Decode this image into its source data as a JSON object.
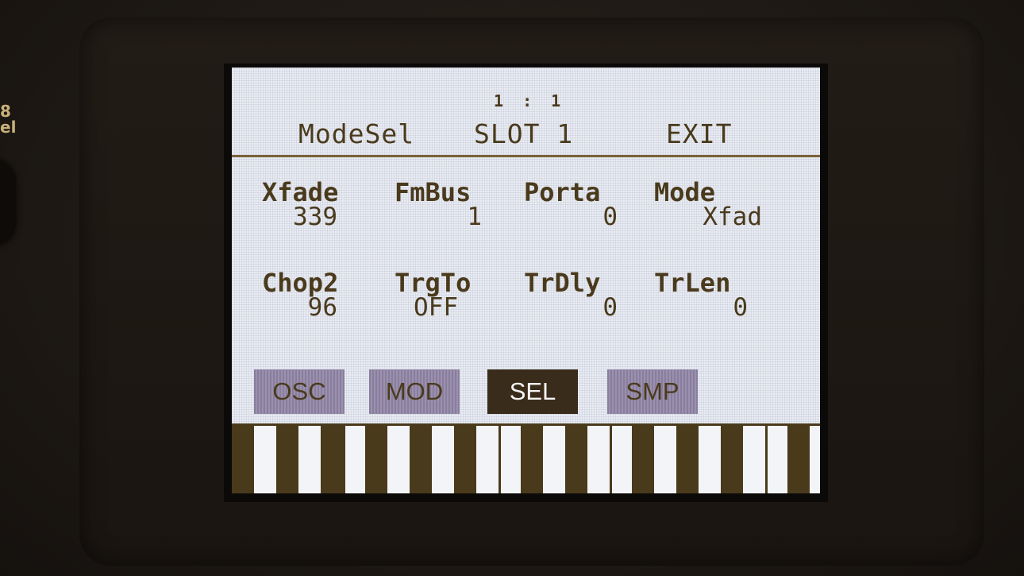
{
  "device": {
    "side_label_top": "8",
    "side_label_bottom": "el"
  },
  "header": {
    "position": "1 : 1",
    "menu": [
      "ModeSel",
      "SLOT 1",
      "EXIT"
    ]
  },
  "parameters": {
    "row1": [
      {
        "label": "Xfade",
        "value": "339"
      },
      {
        "label": "FmBus",
        "value": "1"
      },
      {
        "label": "Porta",
        "value": "0"
      },
      {
        "label": "Mode",
        "value": "Xfad"
      }
    ],
    "row2": [
      {
        "label": "Chop2",
        "value": "96"
      },
      {
        "label": "TrgTo",
        "value": "OFF"
      },
      {
        "label": "TrDly",
        "value": "0"
      },
      {
        "label": "TrLen",
        "value": "0"
      }
    ]
  },
  "tabs": [
    {
      "label": "OSC",
      "active": false
    },
    {
      "label": "MOD",
      "active": false
    },
    {
      "label": "SEL",
      "active": true
    },
    {
      "label": "SMP",
      "active": false
    }
  ],
  "colors": {
    "lcd_background": "#e9ecf3",
    "lcd_text": "#4a3a1c",
    "tab_inactive": "#9b90ad",
    "tab_active": "#3a2c1a"
  }
}
